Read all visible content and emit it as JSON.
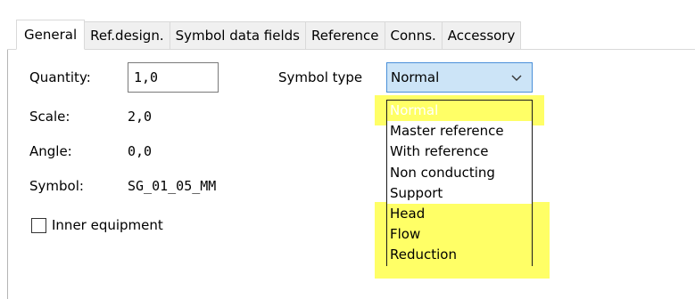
{
  "tabs": [
    {
      "label": "General"
    },
    {
      "label": "Ref.design."
    },
    {
      "label": "Symbol data fields"
    },
    {
      "label": "Reference"
    },
    {
      "label": "Conns."
    },
    {
      "label": "Accessory"
    }
  ],
  "form": {
    "quantity_label": "Quantity:",
    "quantity_value": "1,0",
    "scale_label": "Scale:",
    "scale_value": "2,0",
    "angle_label": "Angle:",
    "angle_value": "0,0",
    "symbol_label": "Symbol:",
    "symbol_value": "SG_01_05_MM",
    "inner_equipment_label": "Inner equipment",
    "inner_equipment_checked": false,
    "symbol_type_label": "Symbol type",
    "symbol_type_value": "Normal"
  },
  "dropdown": {
    "options": [
      {
        "label": "Normal"
      },
      {
        "label": "Master reference"
      },
      {
        "label": "With reference"
      },
      {
        "label": "Non conducting"
      },
      {
        "label": "Support"
      },
      {
        "label": "Head"
      },
      {
        "label": "Flow"
      },
      {
        "label": "Reduction"
      }
    ],
    "selected_index": 0,
    "highlighted_indices": [
      0,
      5,
      6,
      7
    ]
  },
  "colors": {
    "highlight": "#ffff66",
    "selected_item": "#1c6b3c",
    "combo_background": "#cce4f7",
    "combo_border": "#4a90d9"
  }
}
